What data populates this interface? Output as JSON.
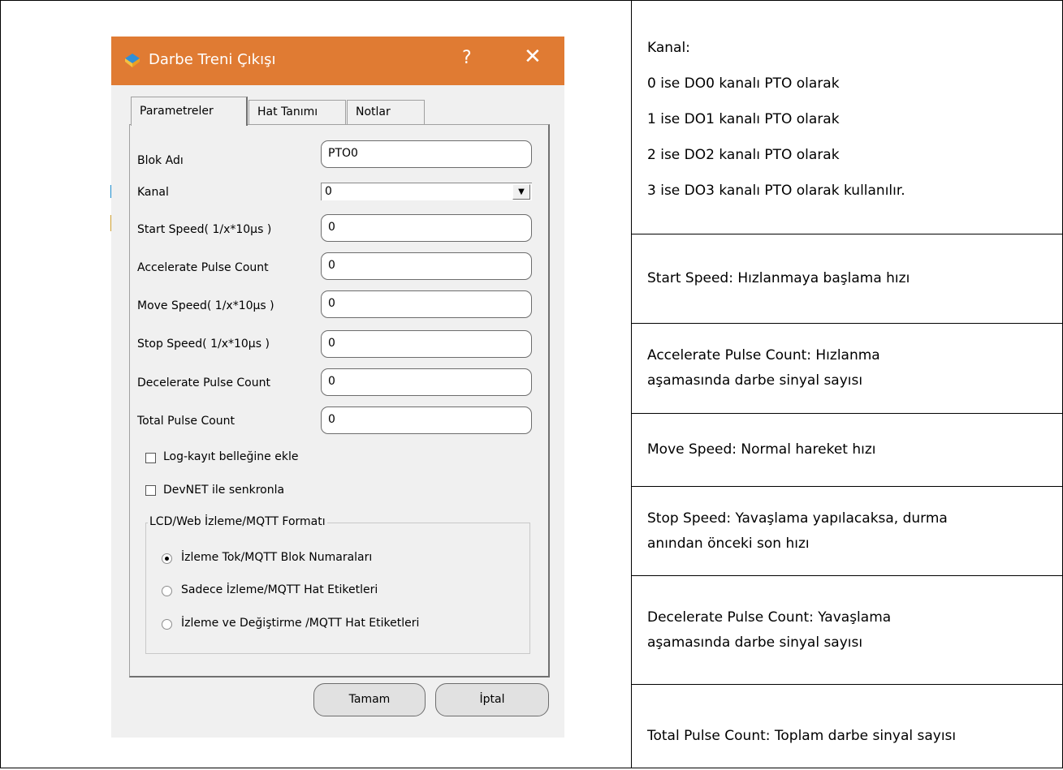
{
  "dialog": {
    "title": "Darbe Treni Çıkışı",
    "help_label": "?",
    "close_label": "✕",
    "tabs": [
      {
        "label": "Parametreler"
      },
      {
        "label": "Hat Tanımı"
      },
      {
        "label": "Notlar"
      }
    ],
    "fields": [
      {
        "label": "Blok Adı",
        "value": "PTO0"
      },
      {
        "label": "Kanal",
        "value": "0"
      },
      {
        "label": "Start Speed( 1/x*10µs )",
        "value": "0"
      },
      {
        "label": "Accelerate Pulse Count",
        "value": "0"
      },
      {
        "label": "Move Speed( 1/x*10µs )",
        "value": "0"
      },
      {
        "label": "Stop Speed( 1/x*10µs )",
        "value": "0"
      },
      {
        "label": "Decelerate Pulse Count",
        "value": "0"
      },
      {
        "label": "Total Pulse Count",
        "value": "0"
      }
    ],
    "checkboxes": [
      {
        "label": "Log-kayıt belleğine ekle",
        "checked": false
      },
      {
        "label": "DevNET ile senkronla",
        "checked": false
      }
    ],
    "group": {
      "legend": "LCD/Web İzleme/MQTT Formatı",
      "options": [
        {
          "label": "İzleme Tok/MQTT Blok Numaraları",
          "selected": true
        },
        {
          "label": "Sadece İzleme/MQTT Hat Etiketleri",
          "selected": false
        },
        {
          "label": "İzleme ve Değiştirme /MQTT Hat Etiketleri",
          "selected": false
        }
      ]
    },
    "ok_label": "Tamam",
    "cancel_label": "İptal",
    "colors": {
      "titlebar": "#e07b33",
      "panel": "#f0f0f0"
    }
  },
  "descriptions": {
    "kanal": [
      "Kanal:",
      "0 ise DO0 kanalı PTO olarak",
      "1 ise DO1 kanalı PTO olarak",
      "2 ise DO2 kanalı PTO olarak",
      "3 ise DO3 kanalı PTO olarak kullanılır."
    ],
    "start_speed": "Start Speed:  Hızlanmaya başlama hızı",
    "accelerate": [
      "Accelerate Pulse Count:  Hızlanma",
      "aşamasında darbe sinyal sayısı"
    ],
    "move_speed": "Move Speed:  Normal hareket hızı",
    "stop_speed": [
      "Stop Speed:  Yavaşlama yapılacaksa, durma",
      "anından önceki son hızı"
    ],
    "decelerate": [
      "Decelerate Pulse Count:  Yavaşlama",
      "aşamasında darbe sinyal sayısı"
    ],
    "total": "Total Pulse Count:  Toplam darbe sinyal sayısı"
  }
}
